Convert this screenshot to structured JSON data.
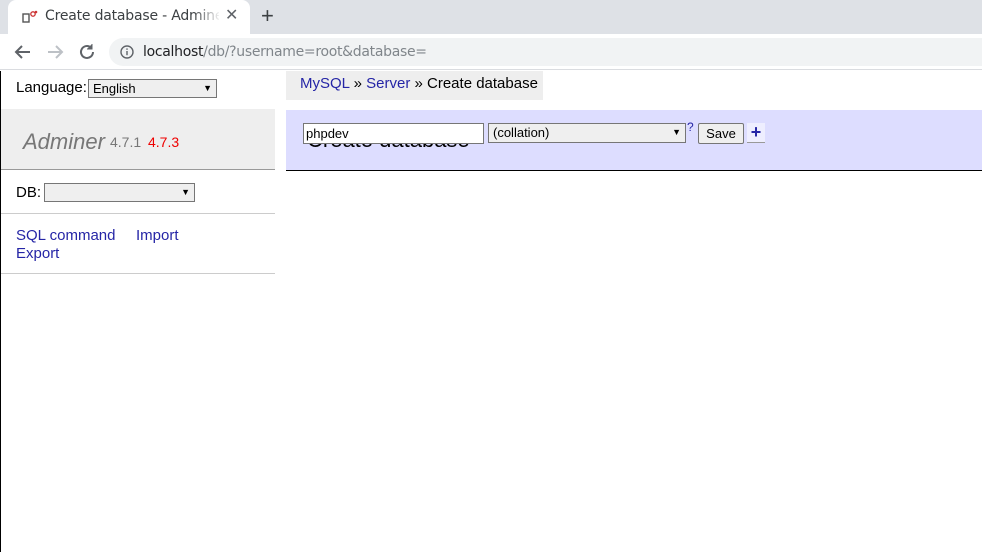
{
  "browser": {
    "tab_title": "Create database - Adminer",
    "tab_close": "✕",
    "new_tab": "+",
    "url_host": "localhost",
    "url_rest": "/db/?username=root&database="
  },
  "sidebar": {
    "language_label": "Language:",
    "language_value": "English",
    "brand": "Adminer",
    "version": "4.7.1",
    "new_version": "4.7.3",
    "db_label": "DB:",
    "db_value": "",
    "links": {
      "sql_command": "SQL command",
      "import": "Import",
      "export": "Export"
    }
  },
  "breadcrumb": {
    "driver": "MySQL",
    "sep1": " » ",
    "server": "Server",
    "sep2": " » ",
    "current": "Create database"
  },
  "main": {
    "title": "Create database",
    "name_value": "phpdev",
    "collation_value": "(collation)",
    "help": "?",
    "save_label": "Save",
    "plus_label": "+"
  }
}
